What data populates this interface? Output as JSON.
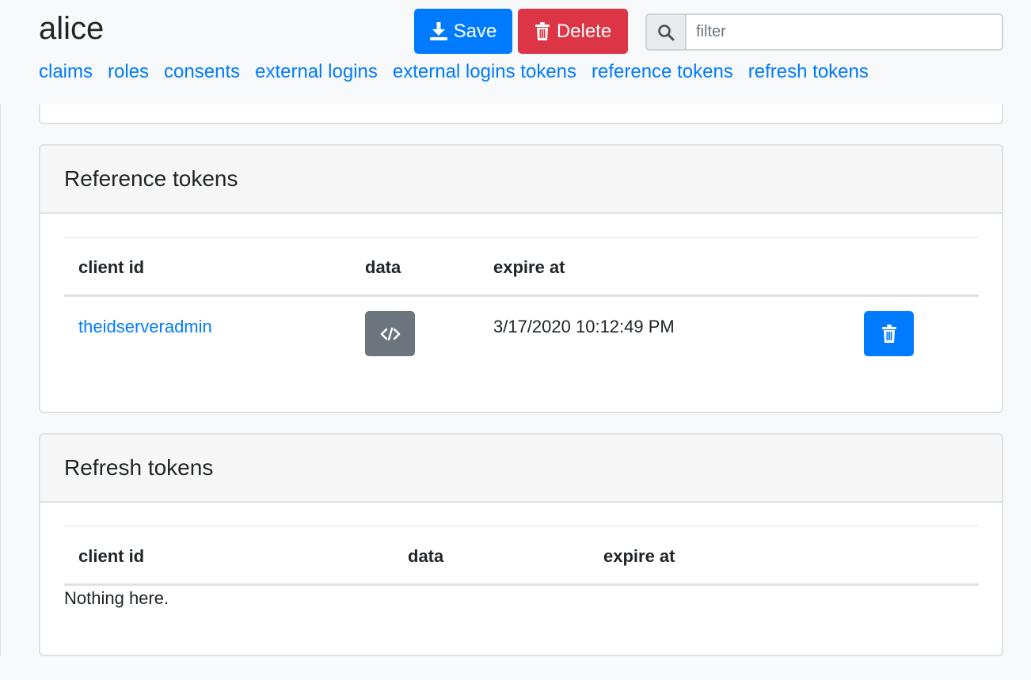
{
  "page": {
    "title": "alice"
  },
  "toolbar": {
    "save_label": "Save",
    "delete_label": "Delete",
    "filter_placeholder": "filter"
  },
  "nav": {
    "items": [
      "claims",
      "roles",
      "consents",
      "external logins",
      "external logins tokens",
      "reference tokens",
      "refresh tokens"
    ]
  },
  "reference_tokens": {
    "title": "Reference tokens",
    "columns": [
      "client id",
      "data",
      "expire at"
    ],
    "rows": [
      {
        "client_id": "theidserveradmin",
        "expire_at": "3/17/2020 10:12:49 PM"
      }
    ]
  },
  "refresh_tokens": {
    "title": "Refresh tokens",
    "columns": [
      "client id",
      "data",
      "expire at"
    ],
    "empty_text": "Nothing here."
  },
  "colors": {
    "primary": "#007bff",
    "danger": "#dc3545",
    "secondary": "#6c757d"
  }
}
